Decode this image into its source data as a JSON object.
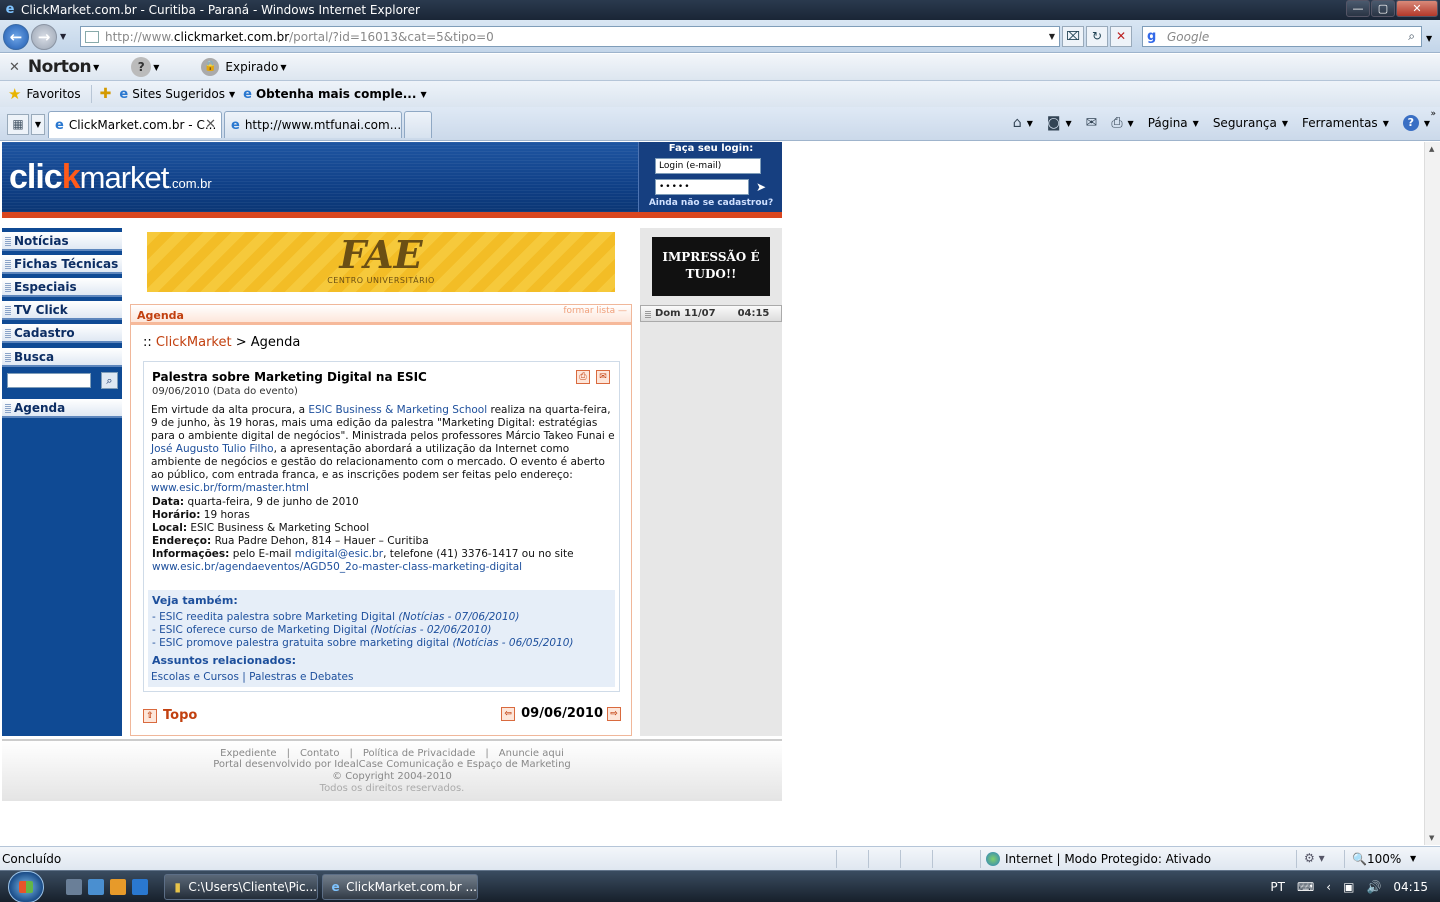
{
  "window": {
    "title": "ClickMarket.com.br - Curitiba - Paraná - Windows Internet Explorer",
    "controls": [
      "—",
      "▢",
      "✕"
    ]
  },
  "address_bar": {
    "url_prefix": "http://www.",
    "url_main": "clickmarket.com.br",
    "url_suffix": "/portal/?id=16013&cat=5&tipo=0",
    "search_placeholder": "Google"
  },
  "norton_toolbar": {
    "brand": "Norton",
    "help": "?",
    "status": "Expirado"
  },
  "favorites_bar": {
    "favorites": "Favoritos",
    "suggested": "Sites Sugeridos",
    "more": "Obtenha mais comple..."
  },
  "tabs": [
    {
      "label": "ClickMarket.com.br - C...",
      "active": true
    },
    {
      "label": "http://www.mtfunai.com....",
      "active": false
    }
  ],
  "command_bar": {
    "page": "Página",
    "security": "Segurança",
    "tools": "Ferramentas"
  },
  "site": {
    "logo": {
      "click": "clic",
      "k": "k",
      "market": "market",
      "tld": ".com.br"
    },
    "login": {
      "title": "Faça seu login:",
      "user_value": "Login (e-mail)",
      "pass_value": "•••••",
      "register": "Ainda não se cadastrou?"
    },
    "nav": [
      {
        "label": "Notícias"
      },
      {
        "label": "Fichas Técnicas"
      },
      {
        "label": "Especiais"
      },
      {
        "label": "TV Click"
      },
      {
        "label": "Cadastro"
      },
      {
        "label": "Busca"
      },
      {
        "label": "Agenda"
      }
    ],
    "banner": {
      "title": "FAE",
      "subtitle": "CENTRO UNIVERSITÁRIO"
    },
    "panel": {
      "tab": "Agenda",
      "formar": "formar lista —",
      "breadcrumb_prefix": "::",
      "breadcrumb_home": "ClickMarket",
      "breadcrumb_sep": ">",
      "breadcrumb_current": "Agenda"
    },
    "article": {
      "title": "Palestra sobre Marketing Digital na ESIC",
      "date": "09/06/2010 (Data do evento)",
      "body_1": "Em virtude da alta procura, a ",
      "body_link1": "ESIC Business & Marketing School",
      "body_2": " realiza na quarta-feira, 9 de junho, às 19 horas, mais uma edição da palestra \"Marketing Digital: estratégias para o ambiente digital de negócios\". Ministrada pelos professores Márcio Takeo Funai e ",
      "body_link2": "José Augusto Tulio Filho",
      "body_3": ", a apresentação abordará a utilização da Internet como ambiente de negócios e gestão do relacionamento com o mercado. O evento é aberto ao público, com entrada franca, e as inscrições podem ser feitas pelo endereço: ",
      "body_link3": "www.esic.br/form/master.html",
      "info": [
        {
          "label": "Data:",
          "value": " quarta-feira, 9 de junho de 2010"
        },
        {
          "label": "Horário:",
          "value": " 19 horas"
        },
        {
          "label": "Local:",
          "value": " ESIC Business & Marketing School"
        },
        {
          "label": "Endereço:",
          "value": " Rua Padre Dehon, 814 – Hauer – Curitiba"
        }
      ],
      "info_contact_label": "Informações:",
      "info_contact_1": " pelo E-mail ",
      "info_contact_email": "mdigital@esic.br",
      "info_contact_2": ", telefone (41) 3376-1417 ou no site",
      "info_contact_url": "www.esic.br/agendaeventos/AGD50_2o-master-class-marketing-digital",
      "see_also_title": "Veja também:",
      "see_also": [
        {
          "title": "- ESIC reedita palestra sobre Marketing Digital",
          "meta": "(Notícias - 07/06/2010)"
        },
        {
          "title": "- ESIC oferece curso de Marketing Digital",
          "meta": "(Notícias - 02/06/2010)"
        },
        {
          "title": "- ESIC promove palestra gratuita sobre marketing digital",
          "meta": "(Notícias - 06/05/2010)"
        }
      ],
      "related_title": "Assuntos relacionados:",
      "related_tag1": "Escolas e Cursos",
      "related_sep": " | ",
      "related_tag2": "Palestras e Debates"
    },
    "topo": "Topo",
    "pager_date": "09/06/2010",
    "ad": "IMPRESSÃO É TUDO!!",
    "clock": {
      "day": "Dom 11/07",
      "time": "04:15"
    },
    "footer": {
      "links": [
        "Expediente",
        "|",
        "Contato",
        "|",
        "Política de Privacidade",
        "|",
        "Anuncie aqui"
      ],
      "credit": "Portal desenvolvido por IdealCase Comunicação e Espaço de Marketing",
      "copyright": "© Copyright 2004-2010",
      "rights": "Todos os direitos reservados."
    }
  },
  "status_bar": {
    "status": "Concluído",
    "zone": "Internet | Modo Protegido: Ativado",
    "zoom": "100%"
  },
  "taskbar": {
    "buttons": [
      {
        "label": "C:\\Users\\Cliente\\Pic..."
      },
      {
        "label": "ClickMarket.com.br ..."
      }
    ],
    "lang": "PT",
    "clock": "04:15"
  }
}
